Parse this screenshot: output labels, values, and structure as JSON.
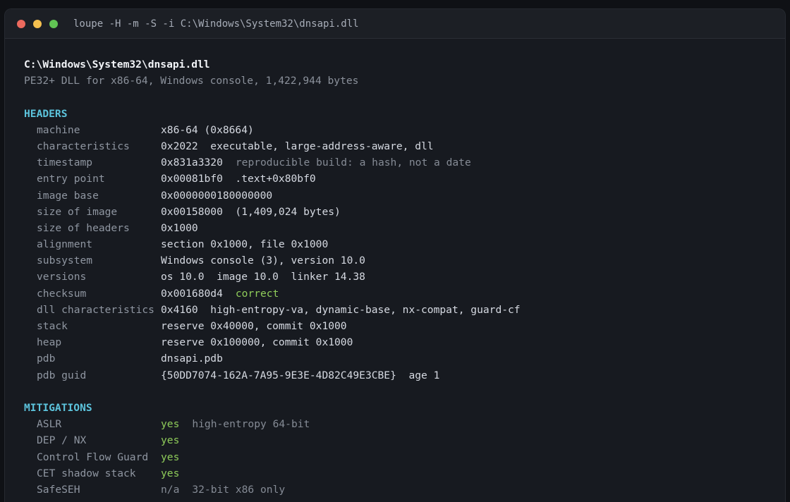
{
  "window": {
    "title": "loupe -H -m -S -i C:\\Windows\\System32\\dnsapi.dll"
  },
  "file": {
    "path": "C:\\Windows\\System32\\dnsapi.dll",
    "summary": "PE32+ DLL for x86-64, Windows console, 1,422,944 bytes"
  },
  "headers": {
    "title": "HEADERS",
    "rows": [
      {
        "key": "machine",
        "value": "x86-64 (0x8664)",
        "note": ""
      },
      {
        "key": "characteristics",
        "value": "0x2022  executable, large-address-aware, dll",
        "note": ""
      },
      {
        "key": "timestamp",
        "value": "0x831a3320",
        "note": "reproducible build: a hash, not a date"
      },
      {
        "key": "entry point",
        "value": "0x00081bf0  .text+0x80bf0",
        "note": ""
      },
      {
        "key": "image base",
        "value": "0x0000000180000000",
        "note": ""
      },
      {
        "key": "size of image",
        "value": "0x00158000  (1,409,024 bytes)",
        "note": ""
      },
      {
        "key": "size of headers",
        "value": "0x1000",
        "note": ""
      },
      {
        "key": "alignment",
        "value": "section 0x1000, file 0x1000",
        "note": ""
      },
      {
        "key": "subsystem",
        "value": "Windows console (3), version 10.0",
        "note": ""
      },
      {
        "key": "versions",
        "value": "os 10.0  image 10.0  linker 14.38",
        "note": ""
      },
      {
        "key": "checksum",
        "value": "0x001680d4",
        "ok": "correct"
      },
      {
        "key": "dll characteristics",
        "value": "0x4160  high-entropy-va, dynamic-base, nx-compat, guard-cf",
        "note": ""
      },
      {
        "key": "stack",
        "value": "reserve 0x40000, commit 0x1000",
        "note": ""
      },
      {
        "key": "heap",
        "value": "reserve 0x100000, commit 0x1000",
        "note": ""
      },
      {
        "key": "pdb",
        "value": "dnsapi.pdb",
        "note": ""
      },
      {
        "key": "pdb guid",
        "value": "{50DD7074-162A-7A95-9E3E-4D82C49E3CBE}  age 1",
        "note": ""
      }
    ]
  },
  "mitigations": {
    "title": "MITIGATIONS",
    "rows": [
      {
        "key": "ASLR",
        "status": "yes",
        "note": "high-entropy 64-bit"
      },
      {
        "key": "DEP / NX",
        "status": "yes",
        "note": ""
      },
      {
        "key": "Control Flow Guard",
        "status": "yes",
        "note": ""
      },
      {
        "key": "CET shadow stack",
        "status": "yes",
        "note": ""
      },
      {
        "key": "SafeSEH",
        "status": "n/a",
        "note": "32-bit x86 only"
      }
    ]
  },
  "colors": {
    "section": "#5cc3dc",
    "ok": "#8fcc5a",
    "muted": "#8b919b"
  }
}
